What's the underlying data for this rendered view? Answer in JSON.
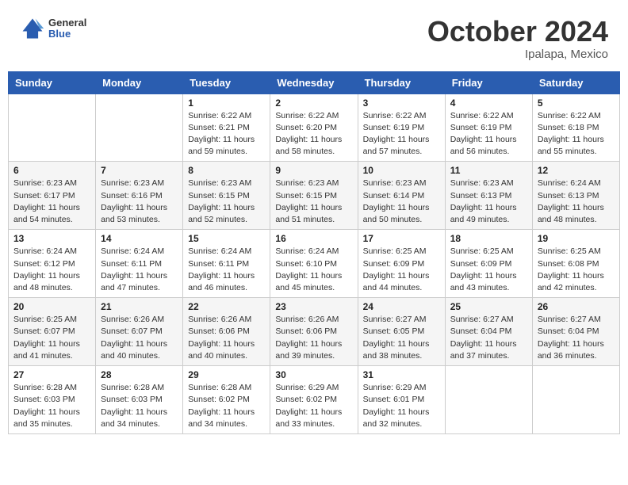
{
  "header": {
    "logo_general": "General",
    "logo_blue": "Blue",
    "month_title": "October 2024",
    "location": "Ipalapa, Mexico"
  },
  "days_of_week": [
    "Sunday",
    "Monday",
    "Tuesday",
    "Wednesday",
    "Thursday",
    "Friday",
    "Saturday"
  ],
  "weeks": [
    [
      {
        "day": "",
        "sunrise": "",
        "sunset": "",
        "daylight": ""
      },
      {
        "day": "",
        "sunrise": "",
        "sunset": "",
        "daylight": ""
      },
      {
        "day": "1",
        "sunrise": "Sunrise: 6:22 AM",
        "sunset": "Sunset: 6:21 PM",
        "daylight": "Daylight: 11 hours and 59 minutes."
      },
      {
        "day": "2",
        "sunrise": "Sunrise: 6:22 AM",
        "sunset": "Sunset: 6:20 PM",
        "daylight": "Daylight: 11 hours and 58 minutes."
      },
      {
        "day": "3",
        "sunrise": "Sunrise: 6:22 AM",
        "sunset": "Sunset: 6:19 PM",
        "daylight": "Daylight: 11 hours and 57 minutes."
      },
      {
        "day": "4",
        "sunrise": "Sunrise: 6:22 AM",
        "sunset": "Sunset: 6:19 PM",
        "daylight": "Daylight: 11 hours and 56 minutes."
      },
      {
        "day": "5",
        "sunrise": "Sunrise: 6:22 AM",
        "sunset": "Sunset: 6:18 PM",
        "daylight": "Daylight: 11 hours and 55 minutes."
      }
    ],
    [
      {
        "day": "6",
        "sunrise": "Sunrise: 6:23 AM",
        "sunset": "Sunset: 6:17 PM",
        "daylight": "Daylight: 11 hours and 54 minutes."
      },
      {
        "day": "7",
        "sunrise": "Sunrise: 6:23 AM",
        "sunset": "Sunset: 6:16 PM",
        "daylight": "Daylight: 11 hours and 53 minutes."
      },
      {
        "day": "8",
        "sunrise": "Sunrise: 6:23 AM",
        "sunset": "Sunset: 6:15 PM",
        "daylight": "Daylight: 11 hours and 52 minutes."
      },
      {
        "day": "9",
        "sunrise": "Sunrise: 6:23 AM",
        "sunset": "Sunset: 6:15 PM",
        "daylight": "Daylight: 11 hours and 51 minutes."
      },
      {
        "day": "10",
        "sunrise": "Sunrise: 6:23 AM",
        "sunset": "Sunset: 6:14 PM",
        "daylight": "Daylight: 11 hours and 50 minutes."
      },
      {
        "day": "11",
        "sunrise": "Sunrise: 6:23 AM",
        "sunset": "Sunset: 6:13 PM",
        "daylight": "Daylight: 11 hours and 49 minutes."
      },
      {
        "day": "12",
        "sunrise": "Sunrise: 6:24 AM",
        "sunset": "Sunset: 6:13 PM",
        "daylight": "Daylight: 11 hours and 48 minutes."
      }
    ],
    [
      {
        "day": "13",
        "sunrise": "Sunrise: 6:24 AM",
        "sunset": "Sunset: 6:12 PM",
        "daylight": "Daylight: 11 hours and 48 minutes."
      },
      {
        "day": "14",
        "sunrise": "Sunrise: 6:24 AM",
        "sunset": "Sunset: 6:11 PM",
        "daylight": "Daylight: 11 hours and 47 minutes."
      },
      {
        "day": "15",
        "sunrise": "Sunrise: 6:24 AM",
        "sunset": "Sunset: 6:11 PM",
        "daylight": "Daylight: 11 hours and 46 minutes."
      },
      {
        "day": "16",
        "sunrise": "Sunrise: 6:24 AM",
        "sunset": "Sunset: 6:10 PM",
        "daylight": "Daylight: 11 hours and 45 minutes."
      },
      {
        "day": "17",
        "sunrise": "Sunrise: 6:25 AM",
        "sunset": "Sunset: 6:09 PM",
        "daylight": "Daylight: 11 hours and 44 minutes."
      },
      {
        "day": "18",
        "sunrise": "Sunrise: 6:25 AM",
        "sunset": "Sunset: 6:09 PM",
        "daylight": "Daylight: 11 hours and 43 minutes."
      },
      {
        "day": "19",
        "sunrise": "Sunrise: 6:25 AM",
        "sunset": "Sunset: 6:08 PM",
        "daylight": "Daylight: 11 hours and 42 minutes."
      }
    ],
    [
      {
        "day": "20",
        "sunrise": "Sunrise: 6:25 AM",
        "sunset": "Sunset: 6:07 PM",
        "daylight": "Daylight: 11 hours and 41 minutes."
      },
      {
        "day": "21",
        "sunrise": "Sunrise: 6:26 AM",
        "sunset": "Sunset: 6:07 PM",
        "daylight": "Daylight: 11 hours and 40 minutes."
      },
      {
        "day": "22",
        "sunrise": "Sunrise: 6:26 AM",
        "sunset": "Sunset: 6:06 PM",
        "daylight": "Daylight: 11 hours and 40 minutes."
      },
      {
        "day": "23",
        "sunrise": "Sunrise: 6:26 AM",
        "sunset": "Sunset: 6:06 PM",
        "daylight": "Daylight: 11 hours and 39 minutes."
      },
      {
        "day": "24",
        "sunrise": "Sunrise: 6:27 AM",
        "sunset": "Sunset: 6:05 PM",
        "daylight": "Daylight: 11 hours and 38 minutes."
      },
      {
        "day": "25",
        "sunrise": "Sunrise: 6:27 AM",
        "sunset": "Sunset: 6:04 PM",
        "daylight": "Daylight: 11 hours and 37 minutes."
      },
      {
        "day": "26",
        "sunrise": "Sunrise: 6:27 AM",
        "sunset": "Sunset: 6:04 PM",
        "daylight": "Daylight: 11 hours and 36 minutes."
      }
    ],
    [
      {
        "day": "27",
        "sunrise": "Sunrise: 6:28 AM",
        "sunset": "Sunset: 6:03 PM",
        "daylight": "Daylight: 11 hours and 35 minutes."
      },
      {
        "day": "28",
        "sunrise": "Sunrise: 6:28 AM",
        "sunset": "Sunset: 6:03 PM",
        "daylight": "Daylight: 11 hours and 34 minutes."
      },
      {
        "day": "29",
        "sunrise": "Sunrise: 6:28 AM",
        "sunset": "Sunset: 6:02 PM",
        "daylight": "Daylight: 11 hours and 34 minutes."
      },
      {
        "day": "30",
        "sunrise": "Sunrise: 6:29 AM",
        "sunset": "Sunset: 6:02 PM",
        "daylight": "Daylight: 11 hours and 33 minutes."
      },
      {
        "day": "31",
        "sunrise": "Sunrise: 6:29 AM",
        "sunset": "Sunset: 6:01 PM",
        "daylight": "Daylight: 11 hours and 32 minutes."
      },
      {
        "day": "",
        "sunrise": "",
        "sunset": "",
        "daylight": ""
      },
      {
        "day": "",
        "sunrise": "",
        "sunset": "",
        "daylight": ""
      }
    ]
  ]
}
